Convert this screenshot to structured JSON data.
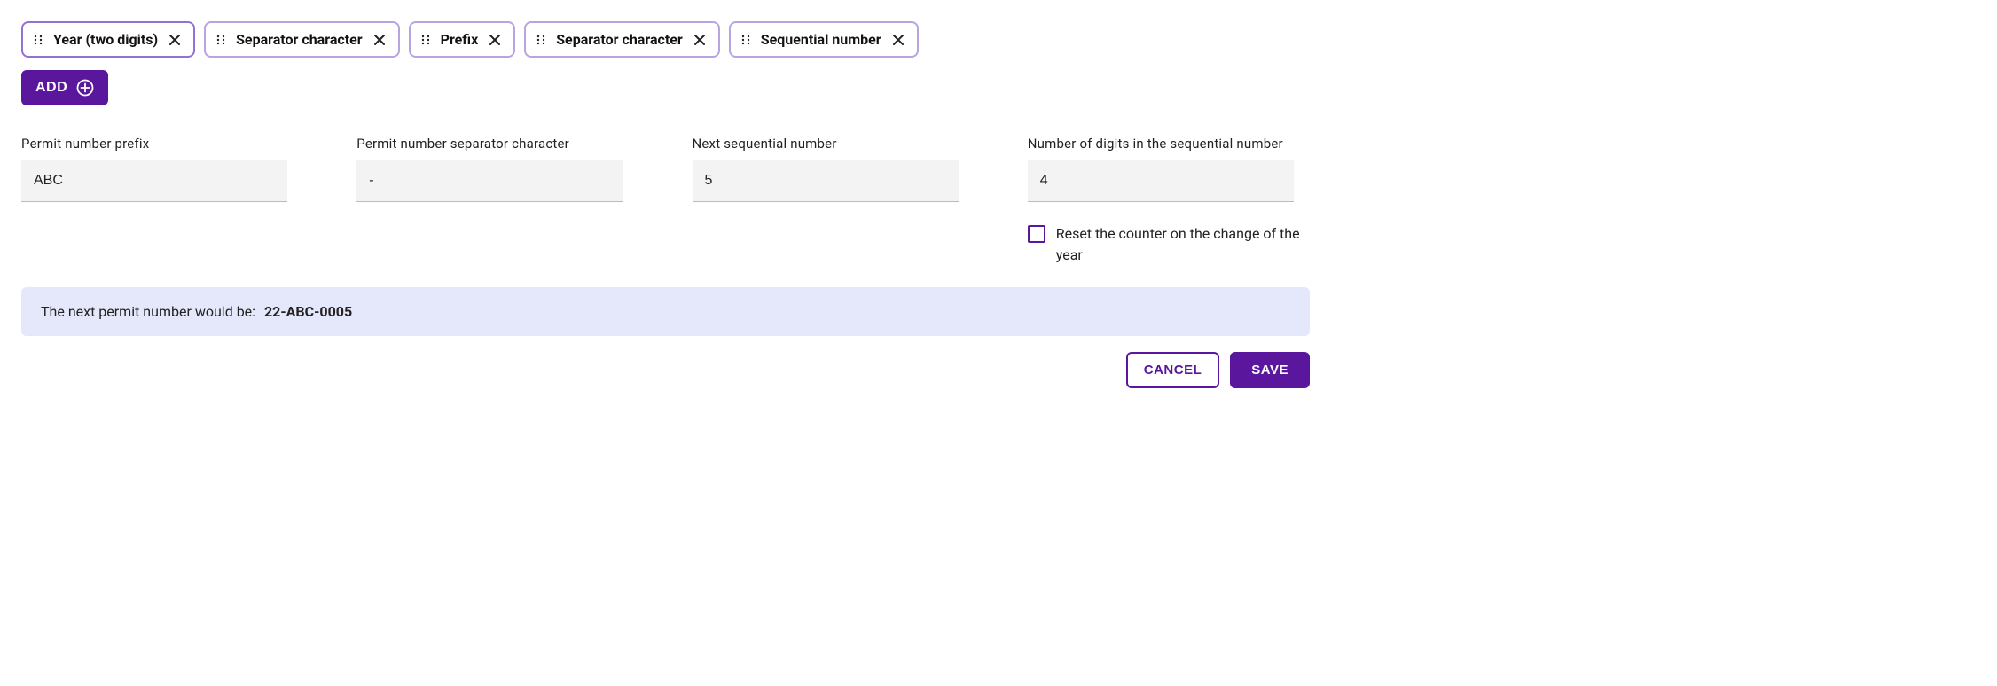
{
  "chips": [
    {
      "label": "Year (two digits)"
    },
    {
      "label": "Separator character"
    },
    {
      "label": "Prefix"
    },
    {
      "label": "Separator character"
    },
    {
      "label": "Sequential number"
    }
  ],
  "addButton": {
    "label": "ADD"
  },
  "fields": {
    "prefix": {
      "label": "Permit number prefix",
      "value": "ABC"
    },
    "separator": {
      "label": "Permit number separator character",
      "value": "-"
    },
    "nextSeq": {
      "label": "Next sequential number",
      "value": "5"
    },
    "numDigits": {
      "label": "Number of digits in the sequential number",
      "value": "4"
    }
  },
  "resetCheckbox": {
    "label": "Reset the counter on the change of the year",
    "checked": false
  },
  "preview": {
    "prefix": "The next permit number would be:",
    "value": "22-ABC-0005"
  },
  "actions": {
    "cancel": "CANCEL",
    "save": "SAVE"
  }
}
